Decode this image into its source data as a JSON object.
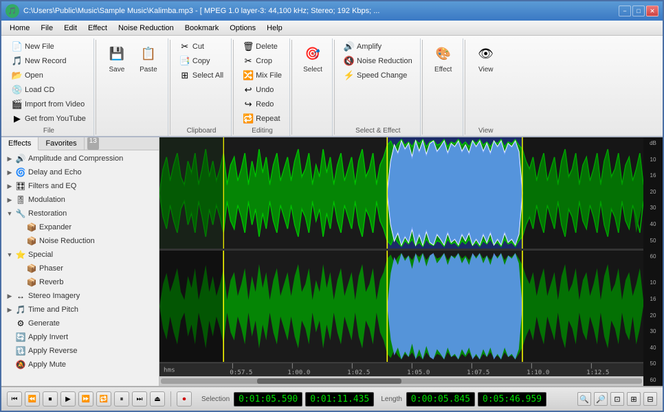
{
  "window": {
    "title": "C:\\Users\\Public\\Music\\Sample Music\\Kalimba.mp3 - [ MPEG 1.0 layer-3: 44,100 kHz; Stereo; 192 Kbps; ...",
    "min_label": "−",
    "max_label": "□",
    "close_label": "✕"
  },
  "menubar": {
    "items": [
      "Home",
      "File",
      "Edit",
      "Effect",
      "Noise Reduction",
      "Bookmark",
      "Options",
      "Help"
    ]
  },
  "ribbon": {
    "groups": [
      {
        "label": "File",
        "buttons": [
          {
            "type": "small",
            "icon": "📄",
            "label": "New File"
          },
          {
            "type": "small",
            "icon": "🎵",
            "label": "New Record"
          },
          {
            "type": "small",
            "icon": "📂",
            "label": "Open"
          },
          {
            "type": "small",
            "icon": "💿",
            "label": "Load CD"
          },
          {
            "type": "small",
            "icon": "🎬",
            "label": "Import from Video"
          },
          {
            "type": "small",
            "icon": "▶",
            "label": "Get from YouTube"
          }
        ]
      },
      {
        "label": "",
        "buttons": [
          {
            "type": "large",
            "icon": "💾",
            "label": "Save"
          },
          {
            "type": "large",
            "icon": "📋",
            "label": "Paste"
          }
        ]
      },
      {
        "label": "Clipboard",
        "buttons": [
          {
            "type": "small",
            "icon": "✂",
            "label": "Cut"
          },
          {
            "type": "small",
            "icon": "📑",
            "label": "Copy"
          },
          {
            "type": "small",
            "icon": "⊞",
            "label": "Select All"
          }
        ]
      },
      {
        "label": "Editing",
        "buttons": [
          {
            "type": "small",
            "icon": "🗑",
            "label": "Delete"
          },
          {
            "type": "small",
            "icon": "✂",
            "label": "Crop"
          },
          {
            "type": "small",
            "icon": "🔀",
            "label": "Mix File"
          },
          {
            "type": "small",
            "icon": "↩",
            "label": "Undo"
          },
          {
            "type": "small",
            "icon": "↪",
            "label": "Redo"
          },
          {
            "type": "small",
            "icon": "🔁",
            "label": "Repeat"
          }
        ]
      },
      {
        "label": "",
        "buttons": [
          {
            "type": "large",
            "icon": "🎯",
            "label": "Select"
          }
        ]
      },
      {
        "label": "Select & Effect",
        "buttons": [
          {
            "type": "small",
            "icon": "🔊",
            "label": "Amplify"
          },
          {
            "type": "small",
            "icon": "🔇",
            "label": "Noise Reduction"
          },
          {
            "type": "small",
            "icon": "⚡",
            "label": "Speed Change"
          }
        ]
      },
      {
        "label": "",
        "buttons": [
          {
            "type": "large",
            "icon": "🎨",
            "label": "Effect"
          }
        ]
      },
      {
        "label": "View",
        "buttons": [
          {
            "type": "large",
            "icon": "👁",
            "label": "View"
          }
        ]
      }
    ]
  },
  "sidebar": {
    "tabs": [
      "Effects",
      "Favorites"
    ],
    "tab_count": "13",
    "tree": [
      {
        "level": 0,
        "expand": "▶",
        "icon": "🔊",
        "label": "Amplitude and Compression",
        "has_children": true,
        "expanded": false
      },
      {
        "level": 0,
        "expand": "▶",
        "icon": "🌀",
        "label": "Delay and Echo",
        "has_children": true,
        "expanded": false
      },
      {
        "level": 0,
        "expand": "▶",
        "icon": "🎛",
        "label": "Filters and EQ",
        "has_children": true,
        "expanded": false
      },
      {
        "level": 0,
        "expand": "▶",
        "icon": "🎚",
        "label": "Modulation",
        "has_children": true,
        "expanded": false
      },
      {
        "level": 0,
        "expand": "▼",
        "icon": "🔧",
        "label": "Restoration",
        "has_children": true,
        "expanded": true
      },
      {
        "level": 1,
        "expand": "",
        "icon": "📦",
        "label": "Expander",
        "has_children": false
      },
      {
        "level": 1,
        "expand": "",
        "icon": "📦",
        "label": "Noise Reduction",
        "has_children": false
      },
      {
        "level": 0,
        "expand": "▼",
        "icon": "⭐",
        "label": "Special",
        "has_children": true,
        "expanded": true
      },
      {
        "level": 1,
        "expand": "",
        "icon": "📦",
        "label": "Phaser",
        "has_children": false
      },
      {
        "level": 1,
        "expand": "",
        "icon": "📦",
        "label": "Reverb",
        "has_children": false
      },
      {
        "level": 0,
        "expand": "▶",
        "icon": "↔",
        "label": "Stereo Imagery",
        "has_children": true,
        "expanded": false
      },
      {
        "level": 0,
        "expand": "▶",
        "icon": "🎵",
        "label": "Time and Pitch",
        "has_children": true,
        "expanded": false
      },
      {
        "level": 0,
        "expand": "",
        "icon": "⚙",
        "label": "Generate",
        "has_children": false
      },
      {
        "level": 0,
        "expand": "",
        "icon": "🔄",
        "label": "Apply Invert",
        "has_children": false
      },
      {
        "level": 0,
        "expand": "",
        "icon": "🔃",
        "label": "Apply Reverse",
        "has_children": false
      },
      {
        "level": 0,
        "expand": "",
        "icon": "🔕",
        "label": "Apply Mute",
        "has_children": false
      }
    ]
  },
  "waveform": {
    "ruler_labels": [
      "hms",
      "0:57.5",
      "1:00.0",
      "1:02.5",
      "1:05.0",
      "1:07.5",
      "1:10.0",
      "1:12.5"
    ],
    "db_scale_top": [
      "dB",
      "10",
      "16",
      "20",
      "30",
      "40",
      "50",
      "60"
    ],
    "db_scale_bottom": [
      "10",
      "16",
      "20",
      "30",
      "40",
      "50",
      "60"
    ]
  },
  "transport": {
    "buttons": [
      "⏮",
      "⏪",
      "⏹",
      "⏵",
      "⏩",
      "⏺",
      "⏸",
      "⏭",
      "⏏"
    ],
    "record_btn": "⏺",
    "selection_label": "Selection",
    "selection_start": "0:01:05.590",
    "selection_end": "0:01:11.435",
    "length_label": "Length",
    "length_val": "0:00:05.845",
    "total_label": "0:05:46.959"
  }
}
